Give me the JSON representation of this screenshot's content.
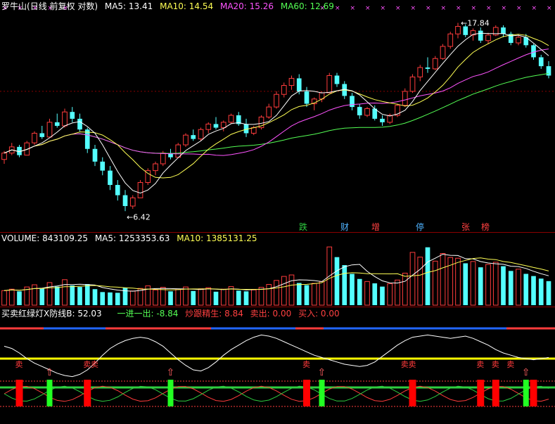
{
  "header_price": {
    "name": "罗牛山",
    "mode": "(日线 前复权 对数)",
    "ma5": "MA5: 13.41",
    "ma10": "MA10: 14.54",
    "ma20": "MA20: 15.26",
    "ma60": "MA60: 12.69"
  },
  "header_volume": {
    "volume": "VOLUME: 843109.25",
    "ma5": "MA5: 1253353.63",
    "ma10": "MA10: 1385131.25"
  },
  "header_indicator": {
    "name": "买卖红绿灯X",
    "line_b": "防线B: 52.03",
    "one_in_out": "一进一出: -8.84",
    "chao_gen": "炒跟精生: 8.84",
    "sell_out": "卖出: 0.00",
    "buy_in": "买入: 0.00"
  },
  "signal_tags": [
    {
      "text": "跌",
      "color": "#2ecc40"
    },
    {
      "text": "财",
      "color": "#4fb3ff"
    },
    {
      "text": "增",
      "color": "#ff4040"
    },
    {
      "text": "停",
      "color": "#4fb3ff"
    },
    {
      "text": "张",
      "color": "#ff4040"
    },
    {
      "text": "榜",
      "color": "#ff4040"
    }
  ],
  "sell_label": "卖",
  "colors": {
    "up": "#ff3c3c",
    "down": "#54ffff",
    "ma5": "#ffffff",
    "ma10": "#ffff54",
    "ma20": "#ff54ff",
    "ma60": "#54ff54",
    "grid": "#8b0000"
  },
  "chart_data": [
    {
      "type": "candlestick",
      "title": "罗牛山 (日线 前复权 对数)",
      "annotations": [
        {
          "text": "17.84",
          "label": "period high"
        },
        {
          "text": "6.42",
          "label": "period low"
        }
      ],
      "ylim": [
        6.0,
        19.0
      ],
      "log_scale": true,
      "ohlc": [
        [
          8.5,
          8.9,
          8.3,
          8.8
        ],
        [
          8.8,
          9.3,
          8.7,
          9.1
        ],
        [
          9.1,
          9.2,
          8.6,
          8.7
        ],
        [
          8.7,
          9.4,
          8.7,
          9.3
        ],
        [
          9.3,
          9.9,
          9.2,
          9.8
        ],
        [
          9.8,
          10.2,
          9.5,
          9.6
        ],
        [
          9.6,
          10.6,
          9.6,
          10.4
        ],
        [
          10.4,
          10.9,
          10.1,
          10.2
        ],
        [
          10.2,
          11.2,
          10.1,
          11.0
        ],
        [
          11.0,
          11.3,
          10.4,
          10.6
        ],
        [
          10.6,
          10.9,
          9.9,
          10.0
        ],
        [
          10.0,
          10.1,
          8.8,
          9.0
        ],
        [
          9.0,
          9.2,
          8.2,
          8.4
        ],
        [
          8.4,
          8.6,
          7.8,
          8.0
        ],
        [
          8.0,
          8.2,
          7.2,
          7.4
        ],
        [
          7.4,
          7.6,
          6.8,
          7.0
        ],
        [
          7.0,
          7.2,
          6.42,
          6.6
        ],
        [
          6.6,
          7.0,
          6.5,
          6.9
        ],
        [
          6.9,
          7.6,
          6.9,
          7.5
        ],
        [
          7.5,
          8.1,
          7.4,
          8.0
        ],
        [
          8.0,
          8.4,
          7.8,
          8.3
        ],
        [
          8.3,
          8.9,
          8.2,
          8.8
        ],
        [
          8.8,
          9.0,
          8.5,
          8.6
        ],
        [
          8.6,
          9.3,
          8.6,
          9.2
        ],
        [
          9.2,
          9.8,
          9.1,
          9.7
        ],
        [
          9.7,
          10.0,
          9.4,
          9.5
        ],
        [
          9.5,
          10.1,
          9.4,
          10.0
        ],
        [
          10.0,
          10.4,
          9.8,
          10.3
        ],
        [
          10.3,
          10.7,
          10.0,
          10.1
        ],
        [
          10.1,
          10.5,
          9.9,
          10.4
        ],
        [
          10.4,
          10.9,
          10.3,
          10.8
        ],
        [
          10.8,
          11.0,
          10.2,
          10.3
        ],
        [
          10.3,
          10.6,
          9.6,
          9.8
        ],
        [
          9.8,
          10.2,
          9.7,
          10.1
        ],
        [
          10.1,
          10.8,
          10.0,
          10.7
        ],
        [
          10.7,
          11.5,
          10.6,
          11.3
        ],
        [
          11.3,
          12.3,
          11.2,
          12.1
        ],
        [
          12.1,
          12.9,
          11.9,
          12.7
        ],
        [
          12.7,
          13.4,
          12.4,
          13.2
        ],
        [
          13.2,
          13.5,
          12.1,
          12.3
        ],
        [
          12.3,
          12.6,
          11.3,
          11.5
        ],
        [
          11.5,
          11.9,
          11.1,
          11.8
        ],
        [
          11.8,
          12.3,
          11.6,
          12.2
        ],
        [
          12.2,
          13.6,
          12.2,
          13.4
        ],
        [
          13.4,
          13.6,
          12.6,
          12.8
        ],
        [
          12.8,
          13.0,
          11.8,
          12.0
        ],
        [
          12.0,
          12.2,
          11.1,
          11.3
        ],
        [
          11.3,
          11.5,
          10.6,
          10.8
        ],
        [
          10.8,
          11.3,
          10.7,
          11.2
        ],
        [
          11.2,
          11.4,
          10.5,
          10.6
        ],
        [
          10.6,
          10.8,
          10.2,
          10.4
        ],
        [
          10.4,
          10.9,
          10.3,
          10.8
        ],
        [
          10.8,
          11.5,
          10.7,
          11.4
        ],
        [
          11.4,
          12.5,
          11.3,
          12.3
        ],
        [
          12.3,
          13.5,
          12.2,
          13.3
        ],
        [
          13.3,
          14.2,
          13.0,
          14.0
        ],
        [
          14.0,
          14.8,
          13.6,
          13.9
        ],
        [
          13.9,
          14.9,
          13.8,
          14.7
        ],
        [
          14.7,
          15.9,
          14.6,
          15.7
        ],
        [
          15.7,
          17.0,
          15.5,
          16.8
        ],
        [
          16.8,
          17.84,
          16.4,
          17.5
        ],
        [
          17.5,
          17.7,
          16.5,
          16.7
        ],
        [
          16.7,
          17.3,
          16.2,
          17.1
        ],
        [
          17.1,
          17.4,
          16.0,
          16.2
        ],
        [
          16.2,
          16.9,
          15.9,
          16.7
        ],
        [
          16.7,
          17.6,
          16.6,
          17.4
        ],
        [
          17.4,
          17.6,
          16.5,
          16.8
        ],
        [
          16.8,
          17.0,
          15.8,
          16.0
        ],
        [
          16.0,
          16.7,
          15.8,
          16.5
        ],
        [
          16.5,
          16.8,
          15.6,
          15.8
        ],
        [
          15.8,
          15.9,
          14.6,
          14.8
        ],
        [
          14.8,
          15.0,
          13.9,
          14.1
        ],
        [
          14.1,
          14.5,
          13.2,
          13.4
        ]
      ]
    },
    {
      "type": "bar",
      "title": "VOLUME",
      "values": [
        4.0,
        4.4,
        3.8,
        5.0,
        5.6,
        4.5,
        6.2,
        5.1,
        7.0,
        5.4,
        5.0,
        5.8,
        4.4,
        3.6,
        3.5,
        3.4,
        4.8,
        3.9,
        4.6,
        5.3,
        4.2,
        4.9,
        3.8,
        4.3,
        5.0,
        3.9,
        4.5,
        4.8,
        3.7,
        4.4,
        5.1,
        4.0,
        3.8,
        4.2,
        4.9,
        5.7,
        6.8,
        7.9,
        8.3,
        6.1,
        5.5,
        6.0,
        6.5,
        16.0,
        13.2,
        11.0,
        8.6,
        7.2,
        6.5,
        6.0,
        5.1,
        5.9,
        6.9,
        8.8,
        14.5,
        13.2,
        15.9,
        12.1,
        14.2,
        13.1,
        12.9,
        11.5,
        12.0,
        10.4,
        11.2,
        11.8,
        10.7,
        9.4,
        9.9,
        8.6,
        8.0,
        7.3,
        6.6
      ]
    },
    {
      "type": "line",
      "title": "买卖红绿灯X",
      "series": [
        {
          "name": "防线B",
          "values": [
            72,
            68,
            60,
            50,
            42,
            36,
            30,
            24,
            20,
            18,
            22,
            30,
            42,
            56,
            68,
            76,
            82,
            86,
            88,
            86,
            80,
            72,
            60,
            48,
            38,
            30,
            28,
            34,
            44,
            56,
            66,
            74,
            82,
            88,
            92,
            90,
            86,
            80,
            74,
            68,
            62,
            56,
            52,
            48,
            44,
            40,
            38,
            36,
            38,
            44,
            54,
            64,
            74,
            82,
            88,
            90,
            92,
            90,
            88,
            86,
            88,
            90,
            86,
            80,
            74,
            66,
            60,
            56,
            52,
            50,
            48,
            50,
            52
          ]
        }
      ]
    }
  ]
}
